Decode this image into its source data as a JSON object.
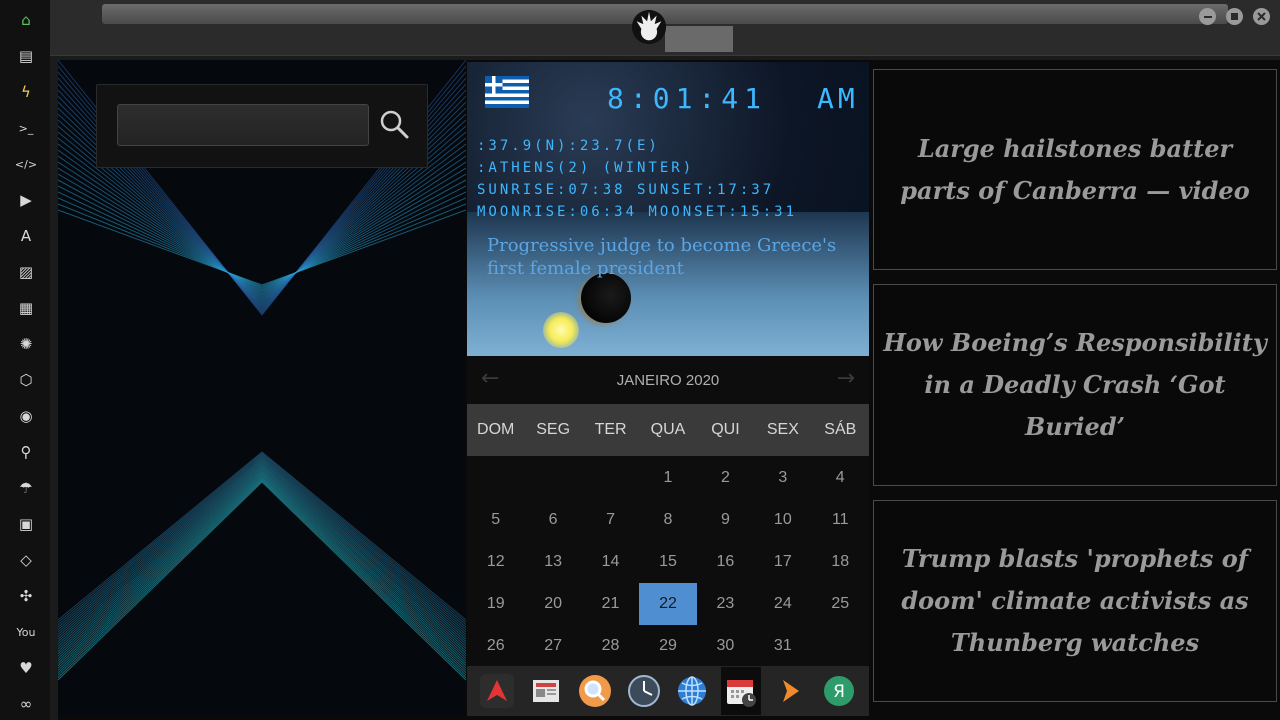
{
  "sidebar": {
    "items": [
      {
        "icon": "home-icon",
        "glyph": "⌂",
        "color": "#5fc45f"
      },
      {
        "icon": "document-icon",
        "glyph": "▤"
      },
      {
        "icon": "lightning-icon",
        "glyph": "ϟ",
        "color": "#f2d04b"
      },
      {
        "icon": "terminal-icon",
        "glyph": ">_"
      },
      {
        "icon": "code-icon",
        "glyph": "</>"
      },
      {
        "icon": "play-icon",
        "glyph": "▶"
      },
      {
        "icon": "translate-icon",
        "glyph": "A"
      },
      {
        "icon": "image-icon",
        "glyph": "▨"
      },
      {
        "icon": "newspaper-icon",
        "glyph": "▦"
      },
      {
        "icon": "galactic-empire-icon",
        "glyph": "✺"
      },
      {
        "icon": "hexagon-icon",
        "glyph": "⬡"
      },
      {
        "icon": "globe-icon",
        "glyph": "◉"
      },
      {
        "icon": "search-icon",
        "glyph": "⚲"
      },
      {
        "icon": "umbrella-icon",
        "glyph": "☂"
      },
      {
        "icon": "contacts-icon",
        "glyph": "▣"
      },
      {
        "icon": "tag-icon",
        "glyph": "◇"
      },
      {
        "icon": "expand-icon",
        "glyph": "✣"
      },
      {
        "icon": "youtube-icon",
        "glyph": "You"
      },
      {
        "icon": "heart-icon",
        "glyph": "♥"
      },
      {
        "icon": "infinity-icon",
        "glyph": "∞"
      }
    ]
  },
  "search": {
    "value": "",
    "placeholder": ""
  },
  "clock": {
    "time": "8:01:41",
    "period": "AM",
    "coords": ":37.9(N):23.7(E)",
    "location": ":ATHENS(2) (WINTER)",
    "sun": "SUNRISE:07:38 SUNSET:17:37",
    "moon": "MOONRISE:06:34 MOONSET:15:31",
    "headline": "Progressive judge to become Greece's first female president"
  },
  "calendar": {
    "title": "JANEIRO 2020",
    "prev": "←",
    "next": "→",
    "weekdays": [
      "DOM",
      "SEG",
      "TER",
      "QUA",
      "QUI",
      "SEX",
      "SÁB"
    ],
    "weeks": [
      [
        "",
        "",
        "",
        "1",
        "2",
        "3",
        "4"
      ],
      [
        "5",
        "6",
        "7",
        "8",
        "9",
        "10",
        "11"
      ],
      [
        "12",
        "13",
        "14",
        "15",
        "16",
        "17",
        "18"
      ],
      [
        "19",
        "20",
        "21",
        "22",
        "23",
        "24",
        "25"
      ],
      [
        "26",
        "27",
        "28",
        "29",
        "30",
        "31",
        ""
      ]
    ],
    "today": "22",
    "today_color": "#4f8fd1"
  },
  "dock": [
    {
      "name": "dock-app-arch",
      "icon": "arch-logo-icon"
    },
    {
      "name": "dock-app-news",
      "icon": "newspaper-icon"
    },
    {
      "name": "dock-app-search",
      "icon": "magnifier-icon"
    },
    {
      "name": "dock-app-clock",
      "icon": "clock-icon"
    },
    {
      "name": "dock-app-browser",
      "icon": "globe-icon"
    },
    {
      "name": "dock-app-calendar",
      "icon": "calendar-icon",
      "active": true
    },
    {
      "name": "dock-app-forward",
      "icon": "chevron-right-icon"
    },
    {
      "name": "dock-app-yandex",
      "icon": "yandex-icon"
    }
  ],
  "news": [
    {
      "headline": "Large hailstones batter parts of Canberra — video"
    },
    {
      "headline": "How Boeing’s Responsibility in a Deadly Crash ‘Got Buried’"
    },
    {
      "headline": "Trump blasts 'prophets of doom' climate activists as Thunberg watches"
    }
  ],
  "colors": {
    "accent": "#3db7ff",
    "sidebar_bg": "#111111",
    "news_text": "#9a9a9a"
  }
}
